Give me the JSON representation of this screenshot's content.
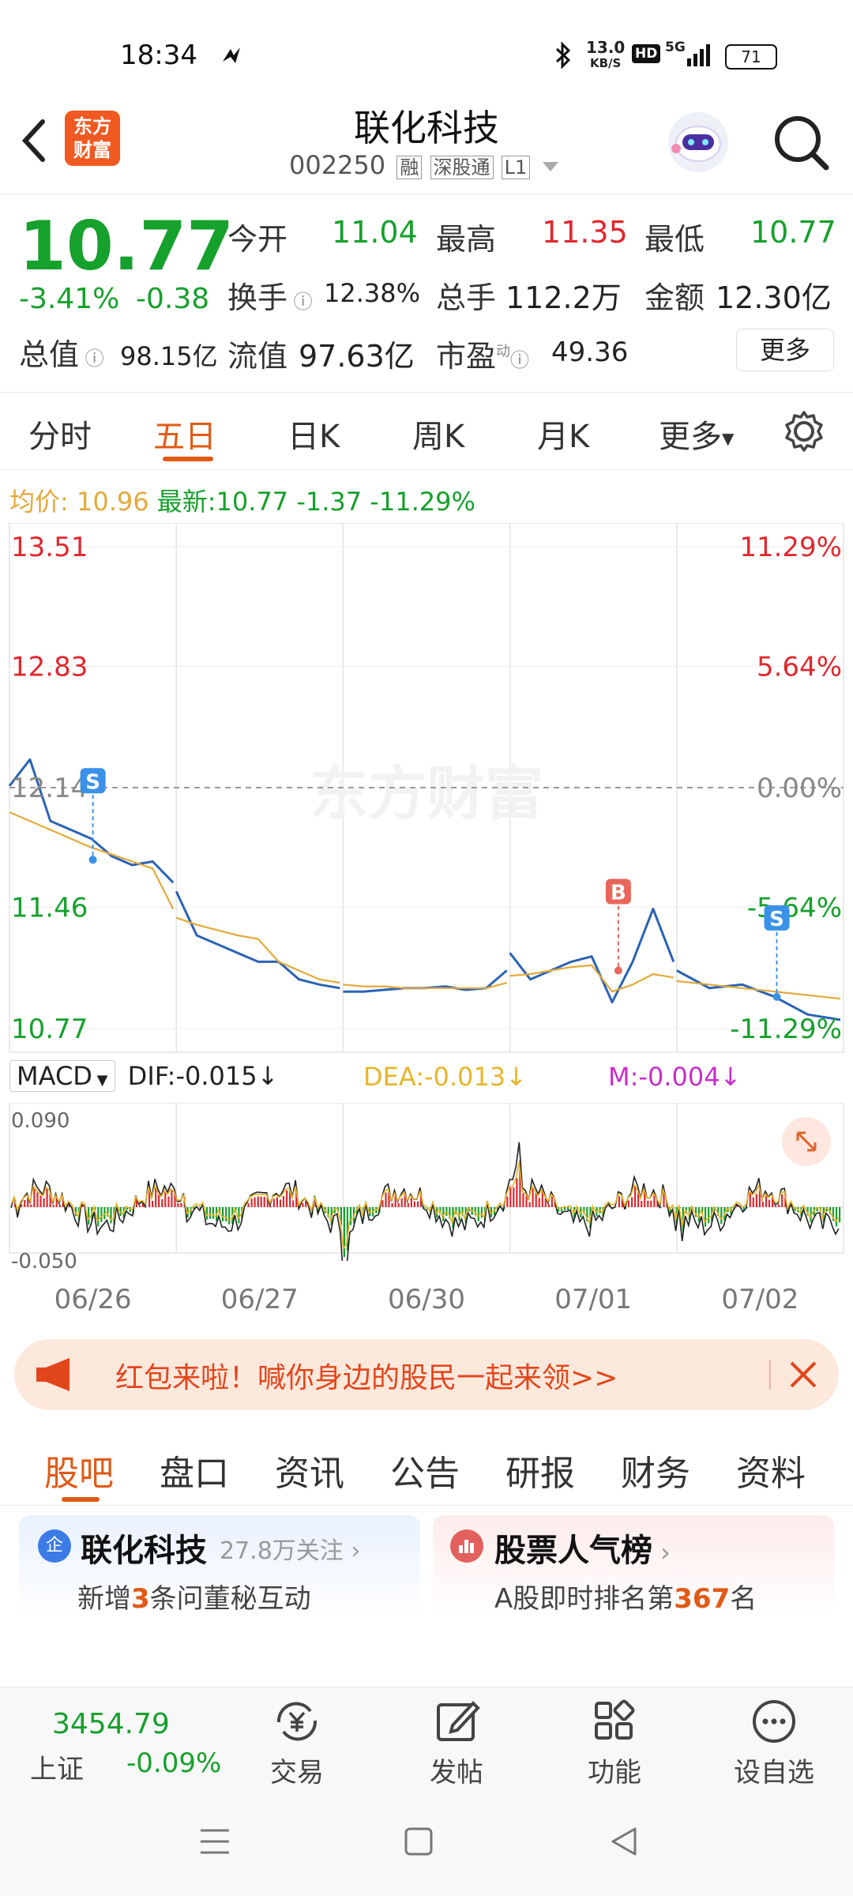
{
  "status_bar": {
    "time": "18:34",
    "net_speed": "13.0",
    "net_unit": "KB/S",
    "hd": "HD",
    "signal": "5G",
    "battery": "71"
  },
  "header": {
    "logo_text_1": "东方",
    "logo_text_2": "财富",
    "title": "联化科技",
    "code": "002250",
    "tag_rong": "融",
    "tag_sgt": "深股通",
    "tag_level": "L1"
  },
  "quote": {
    "price": "10.77",
    "change_pct": "-3.41%",
    "change": "-0.38",
    "open_label": "今开",
    "open": "11.04",
    "high_label": "最高",
    "high": "11.35",
    "low_label": "最低",
    "low": "10.77",
    "turnover_label": "换手",
    "turnover": "12.38%",
    "volume_label": "总手",
    "volume": "112.2万",
    "amount_label": "金额",
    "amount": "12.30亿",
    "mcap_label": "总值",
    "mcap": "98.15亿",
    "float_label": "流值",
    "float": "97.63亿",
    "pe_label": "市盈",
    "pe_sup": "动",
    "pe": "49.36",
    "more": "更多"
  },
  "tabs": [
    "分时",
    "五日",
    "日K",
    "周K",
    "月K",
    "更多"
  ],
  "active_tab": 1,
  "info_line": {
    "avg_label": "均价:",
    "avg": "10.96",
    "latest_label": "最新:",
    "latest": "10.77",
    "chg": "-1.37",
    "chg_pct": "-11.29%"
  },
  "watermark": "东方财富",
  "macd": {
    "selector": "MACD",
    "dif": "DIF:-0.015",
    "dea": "DEA:-0.013",
    "m": "M:-0.004",
    "top": "0.090",
    "bottom": "-0.050"
  },
  "chart_data": {
    "type": "line",
    "title": "",
    "x_days": [
      "06/26",
      "06/27",
      "06/30",
      "07/01",
      "07/02"
    ],
    "y_left_ticks": [
      "13.51",
      "12.83",
      "12.14",
      "11.46",
      "10.77"
    ],
    "y_right_ticks": [
      "11.29%",
      "5.64%",
      "0.00%",
      "-5.64%",
      "-11.29%"
    ],
    "ylim": [
      10.77,
      13.51
    ],
    "prev_close": 12.14,
    "grid": true,
    "series": [
      {
        "name": "",
        "color": "#2b63b5",
        "values": [
          12.15,
          12.3,
          11.95,
          11.9,
          11.85,
          11.75,
          11.7,
          11.72,
          11.6,
          11.55,
          11.3,
          11.25,
          11.2,
          11.15,
          11.15,
          11.05,
          11.02,
          11.0,
          10.98,
          10.98,
          10.99,
          11.0,
          11.0,
          11.01,
          10.99,
          11.0,
          11.1,
          11.2,
          11.05,
          11.1,
          11.15,
          11.18,
          10.92,
          11.15,
          11.45,
          11.15,
          11.1,
          11.0,
          11.02,
          10.95,
          10.85,
          10.82
        ]
      },
      {
        "name": "",
        "color": "#e3a93a",
        "values": [
          12.0,
          11.95,
          11.9,
          11.85,
          11.8,
          11.76,
          11.72,
          11.68,
          11.45,
          11.4,
          11.36,
          11.33,
          11.3,
          11.28,
          11.15,
          11.1,
          11.05,
          11.03,
          11.02,
          11.01,
          11.01,
          11.0,
          11.0,
          11.0,
          11.0,
          11.0,
          11.03,
          11.07,
          11.08,
          11.1,
          11.12,
          11.13,
          10.98,
          11.02,
          11.08,
          11.06,
          11.04,
          11.02,
          11.0,
          10.98,
          10.96,
          10.94
        ]
      }
    ],
    "markers": [
      {
        "label": "S",
        "day": 0,
        "at": 0.5,
        "price": 11.73,
        "color": "#3a92e8"
      },
      {
        "label": "B",
        "day": 3,
        "at": 0.65,
        "price": 11.1,
        "color": "#e8675a"
      },
      {
        "label": "S",
        "day": 4,
        "at": 0.6,
        "price": 10.95,
        "color": "#3a92e8"
      }
    ]
  },
  "banner": {
    "text": "红包来啦！喊你身边的股民一起来领>>"
  },
  "subtabs": [
    "股吧",
    "盘口",
    "资讯",
    "公告",
    "研报",
    "财务",
    "资料"
  ],
  "card_left": {
    "badge": "企",
    "title": "联化科技",
    "follow": "27.8万关注",
    "line_pre": "新增",
    "line_num": "3",
    "line_post": "条问董秘互动"
  },
  "card_right": {
    "title": "股票人气榜",
    "line_pre": "A股即时排名第",
    "line_num": "367",
    "line_post": "名"
  },
  "bottom": {
    "index_value": "3454.79",
    "index_name": "上证",
    "index_chg": "-0.09%",
    "trade": "交易",
    "post": "发帖",
    "func": "功能",
    "watch": "设自选"
  }
}
